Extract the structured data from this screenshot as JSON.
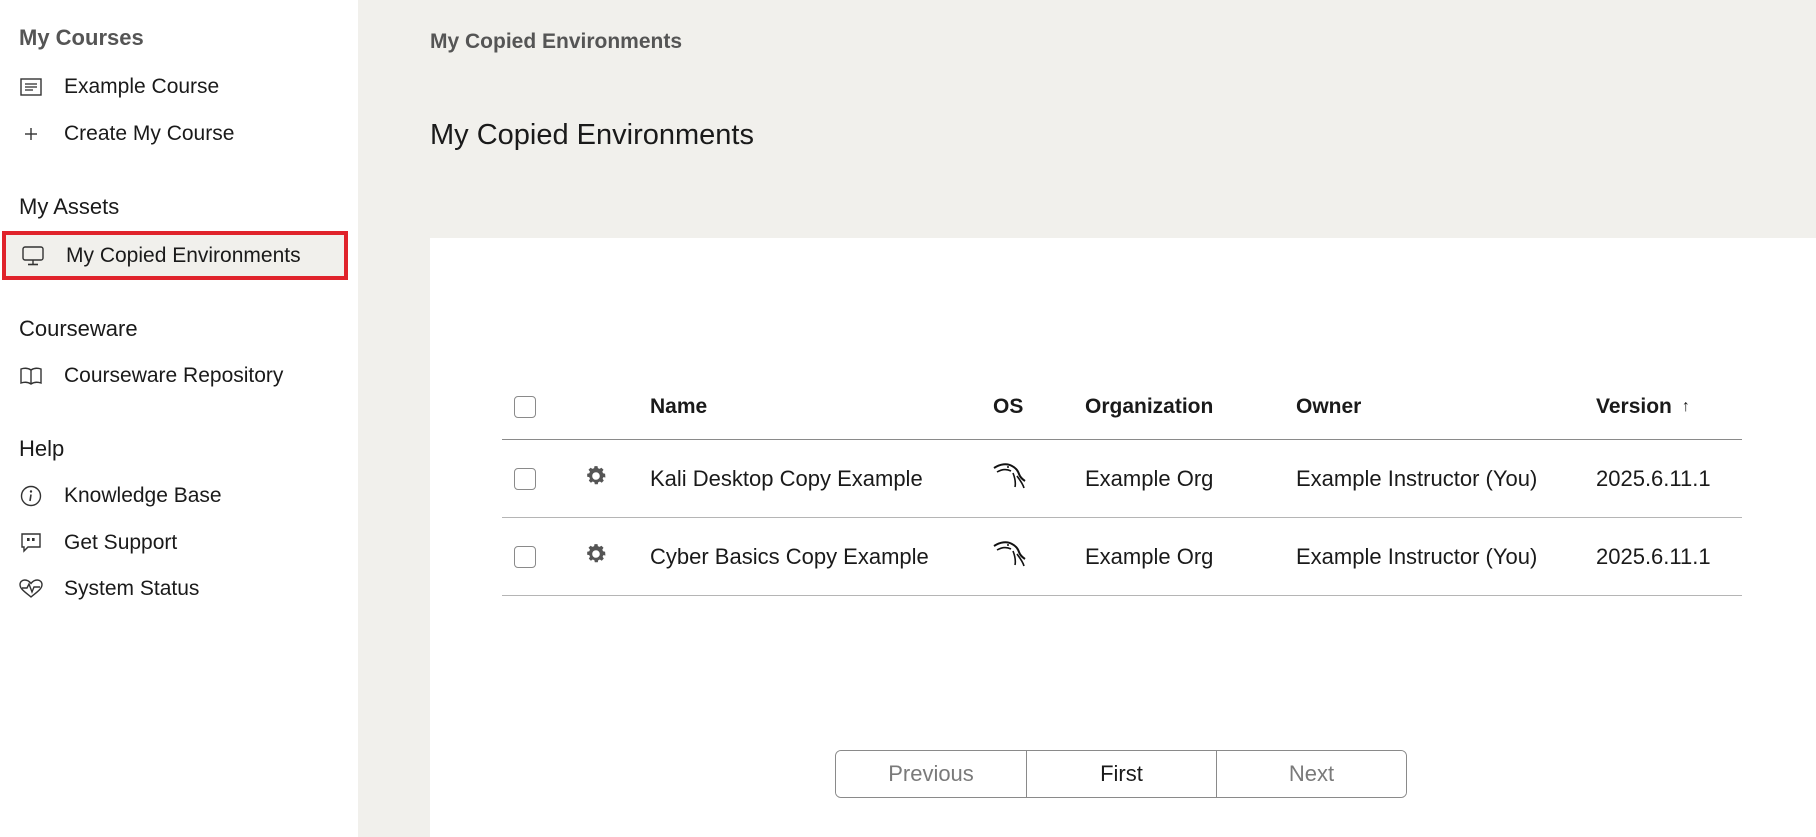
{
  "sidebar": {
    "my_courses": {
      "title": "My Courses",
      "items": [
        {
          "label": "Example Course",
          "icon": "list-icon"
        },
        {
          "label": "Create My Course",
          "icon": "plus-icon"
        }
      ]
    },
    "my_assets": {
      "title": "My Assets",
      "items": [
        {
          "label": "My Copied Environments",
          "icon": "monitor-icon",
          "active": true
        }
      ]
    },
    "courseware": {
      "title": "Courseware",
      "items": [
        {
          "label": "Courseware Repository",
          "icon": "book-icon"
        }
      ]
    },
    "help": {
      "title": "Help",
      "items": [
        {
          "label": "Knowledge Base",
          "icon": "info-icon"
        },
        {
          "label": "Get Support",
          "icon": "chat-quote-icon"
        },
        {
          "label": "System Status",
          "icon": "heart-pulse-icon"
        }
      ]
    }
  },
  "main": {
    "breadcrumb": "My Copied Environments",
    "title": "My Copied Environments",
    "table": {
      "columns": {
        "name": "Name",
        "os": "OS",
        "organization": "Organization",
        "owner": "Owner",
        "version": "Version",
        "sort_indicator": "↑"
      },
      "rows": [
        {
          "name": "Kali Desktop Copy Example",
          "os_icon": "kali-dragon-icon",
          "organization": "Example Org",
          "owner": "Example Instructor (You)",
          "version": "2025.6.11.1"
        },
        {
          "name": "Cyber Basics Copy Example",
          "os_icon": "kali-dragon-icon",
          "organization": "Example Org",
          "owner": "Example Instructor (You)",
          "version": "2025.6.11.1"
        }
      ]
    },
    "pagination": {
      "previous": "Previous",
      "first": "First",
      "next": "Next"
    }
  },
  "colors": {
    "highlight_border": "#e0232b",
    "main_bg": "#f1f0ec"
  }
}
